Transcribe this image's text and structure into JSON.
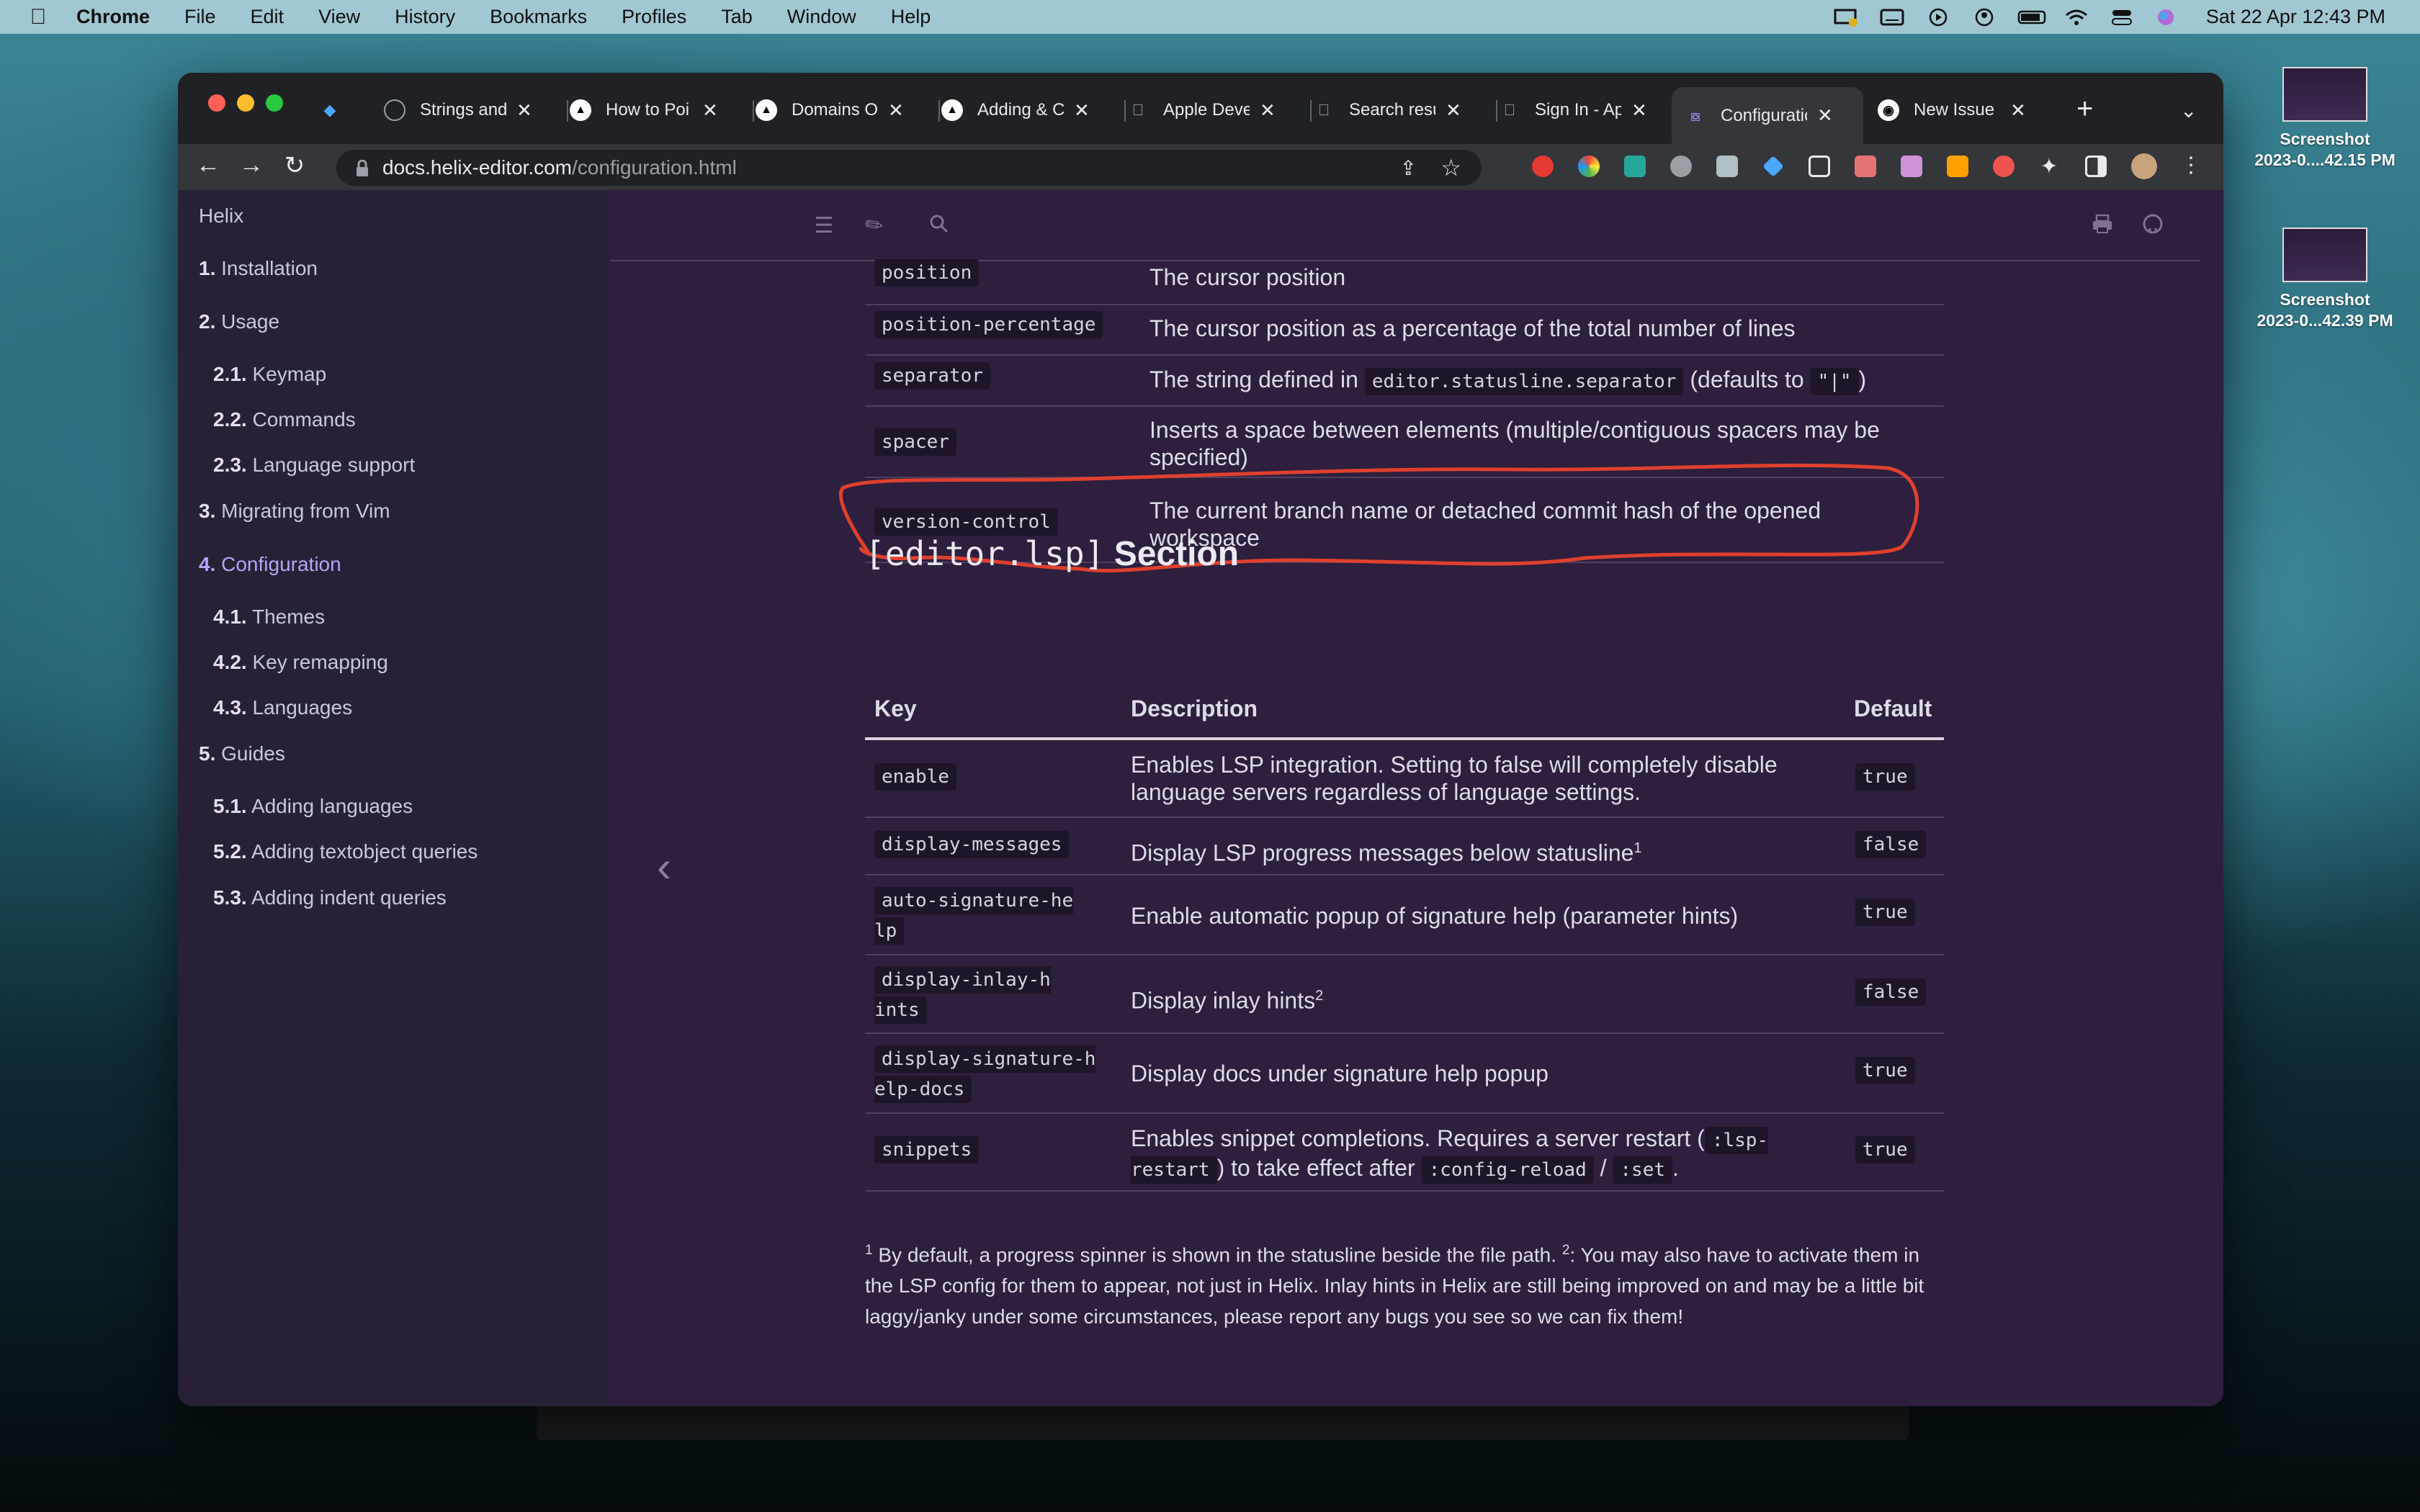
{
  "menubar": {
    "app": "Chrome",
    "items": [
      "File",
      "Edit",
      "View",
      "History",
      "Bookmarks",
      "Profiles",
      "Tab",
      "Window",
      "Help"
    ],
    "clock": "Sat 22 Apr  12:43 PM"
  },
  "desktop": {
    "items": [
      {
        "label1": "Screenshot",
        "label2": "2023-0....42.15 PM"
      },
      {
        "label1": "Screenshot",
        "label2": "2023-0...42.39 PM"
      }
    ]
  },
  "tabs": [
    {
      "title": "",
      "icon": "gem-icon"
    },
    {
      "title": "Strings and",
      "icon": "globe-icon"
    },
    {
      "title": "How to Poi",
      "icon": "triangle-icon"
    },
    {
      "title": "Domains O",
      "icon": "triangle-icon"
    },
    {
      "title": "Adding & C",
      "icon": "triangle-icon"
    },
    {
      "title": "Apple Deve",
      "icon": "apple-icon"
    },
    {
      "title": "Search resu",
      "icon": "apple-icon"
    },
    {
      "title": "Sign In - Ap",
      "icon": "apple-icon"
    },
    {
      "title": "Configuratio",
      "icon": "helix-icon"
    },
    {
      "title": "New Issue",
      "icon": "github-icon"
    }
  ],
  "address": {
    "host": "docs.helix-editor.com",
    "path": "/configuration.html"
  },
  "sidebar": {
    "title": "Helix",
    "items": [
      {
        "num": "1.",
        "label": "Installation"
      },
      {
        "num": "2.",
        "label": "Usage"
      },
      {
        "num": "2.1.",
        "label": "Keymap"
      },
      {
        "num": "2.2.",
        "label": "Commands"
      },
      {
        "num": "2.3.",
        "label": "Language support"
      },
      {
        "num": "3.",
        "label": "Migrating from Vim"
      },
      {
        "num": "4.",
        "label": "Configuration"
      },
      {
        "num": "4.1.",
        "label": "Themes"
      },
      {
        "num": "4.2.",
        "label": "Key remapping"
      },
      {
        "num": "4.3.",
        "label": "Languages"
      },
      {
        "num": "5.",
        "label": "Guides"
      },
      {
        "num": "5.1.",
        "label": "Adding languages"
      },
      {
        "num": "5.2.",
        "label": "Adding textobject queries"
      },
      {
        "num": "5.3.",
        "label": "Adding indent queries"
      }
    ]
  },
  "statusline_rows": [
    {
      "key": "position",
      "desc": "The cursor position"
    },
    {
      "key": "position-percentage",
      "desc": "The cursor position as a percentage of the total number of lines"
    },
    {
      "key": "separator",
      "desc_a": "The string defined in",
      "desc_code": "editor.statusline.separator",
      "desc_b": "(defaults to",
      "desc_code2": "\"|\"",
      "desc_c": ")"
    },
    {
      "key": "spacer",
      "desc": "Inserts a space between elements (multiple/contiguous spacers may be specified)"
    },
    {
      "key": "version-control",
      "desc": "The current branch name or detached commit hash of the opened workspace"
    }
  ],
  "lsp": {
    "heading_code": "[editor.lsp]",
    "heading_text": "Section",
    "headers": {
      "key": "Key",
      "desc": "Description",
      "default": "Default"
    },
    "rows": [
      {
        "key": "enable",
        "desc": "Enables LSP integration. Setting to false will completely disable language servers regardless of language settings.",
        "default": "true"
      },
      {
        "key": "display-messages",
        "desc": "Display LSP progress messages below statusline",
        "sup": "1",
        "default": "false"
      },
      {
        "key": "auto-signature-help",
        "desc": "Enable automatic popup of signature help (parameter hints)",
        "default": "true"
      },
      {
        "key": "display-inlay-hints",
        "desc": "Display inlay hints",
        "sup": "2",
        "default": "false"
      },
      {
        "key": "display-signature-help-docs",
        "desc": "Display docs under signature help popup",
        "default": "true"
      },
      {
        "key": "snippets",
        "desc_a": "Enables snippet completions. Requires a server restart (",
        "desc_code": ":lsp-restart",
        "desc_b": ") to take effect after",
        "desc_code2": ":config-reload",
        "desc_c": "/",
        "desc_code3": ":set",
        "desc_d": ".",
        "default": "true"
      }
    ],
    "footnote_1": "By default, a progress spinner is shown in the statusline beside the file path.",
    "footnote_2": ": You may also have to activate them in the LSP config for them to appear, not just in Helix. Inlay hints in Helix are still being improved on and may be a little bit laggy/janky under some circumstances, please report any bugs you see so we can fix them!"
  },
  "colors": {
    "accent": "#b7a4f7",
    "annotation": "#e0402e"
  }
}
